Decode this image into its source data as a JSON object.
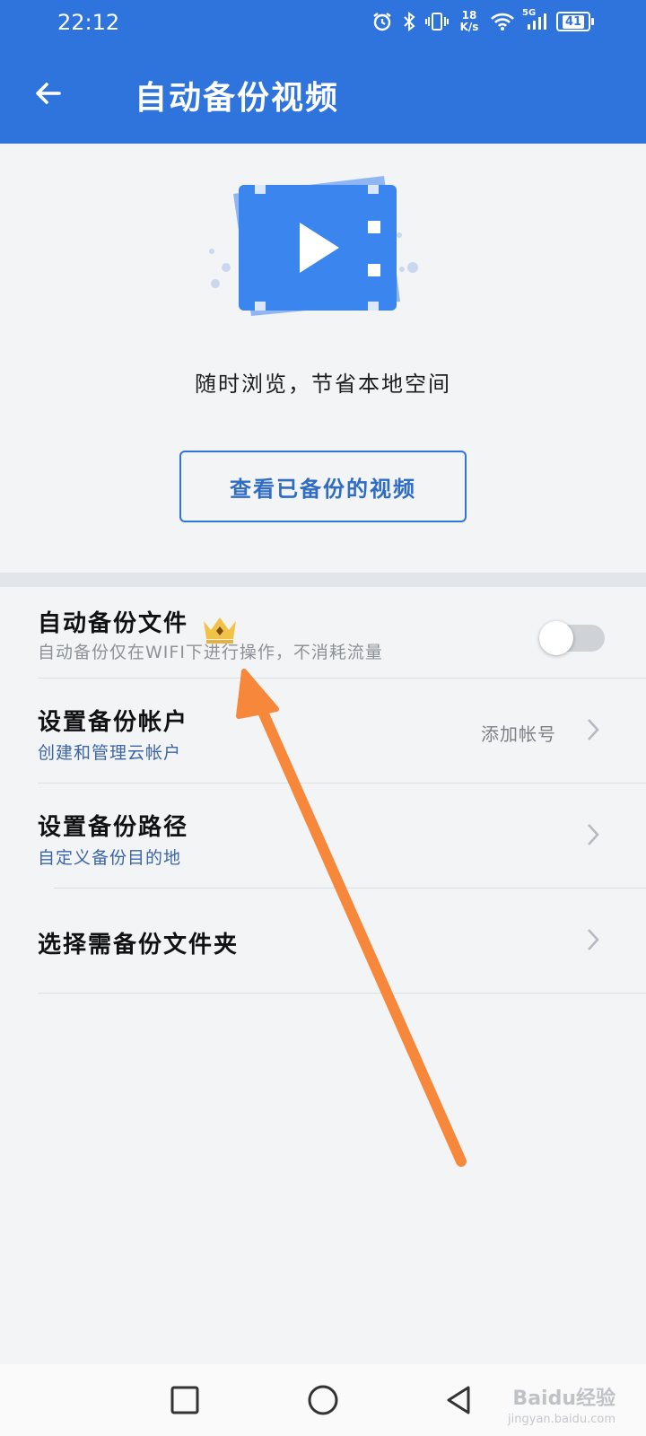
{
  "status_bar": {
    "time": "22:12",
    "speed_value": "18",
    "speed_unit": "K/s",
    "network": "5G",
    "battery": "41",
    "icons": [
      "alarm-icon",
      "bluetooth-icon",
      "vibrate-icon",
      "wifi-icon",
      "signal-icon",
      "battery-icon"
    ]
  },
  "header": {
    "title": "自动备份视频",
    "back_icon": "arrow-left-icon"
  },
  "hero": {
    "tagline": "随时浏览，节省本地空间",
    "view_button_label": "查看已备份的视频"
  },
  "settings": [
    {
      "title": "自动备份文件",
      "subtitle": "自动备份仅在WIFI下进行操作，不消耗流量",
      "badge_icon": "crown-icon",
      "toggle_on": false
    },
    {
      "title": "设置备份帐户",
      "subtitle": "创建和管理云帐户",
      "value": "添加帐号"
    },
    {
      "title": "设置备份路径",
      "subtitle": "自定义备份目的地"
    },
    {
      "title": "选择需备份文件夹"
    }
  ],
  "nav_bar": {
    "icons": [
      "recents-square-icon",
      "home-circle-icon",
      "back-triangle-icon"
    ]
  },
  "watermark": {
    "text": "Baidu经验",
    "sub": "jingyan.baidu.com"
  },
  "colors": {
    "accent": "#2f73dc",
    "annotation_arrow": "#f7873a"
  }
}
